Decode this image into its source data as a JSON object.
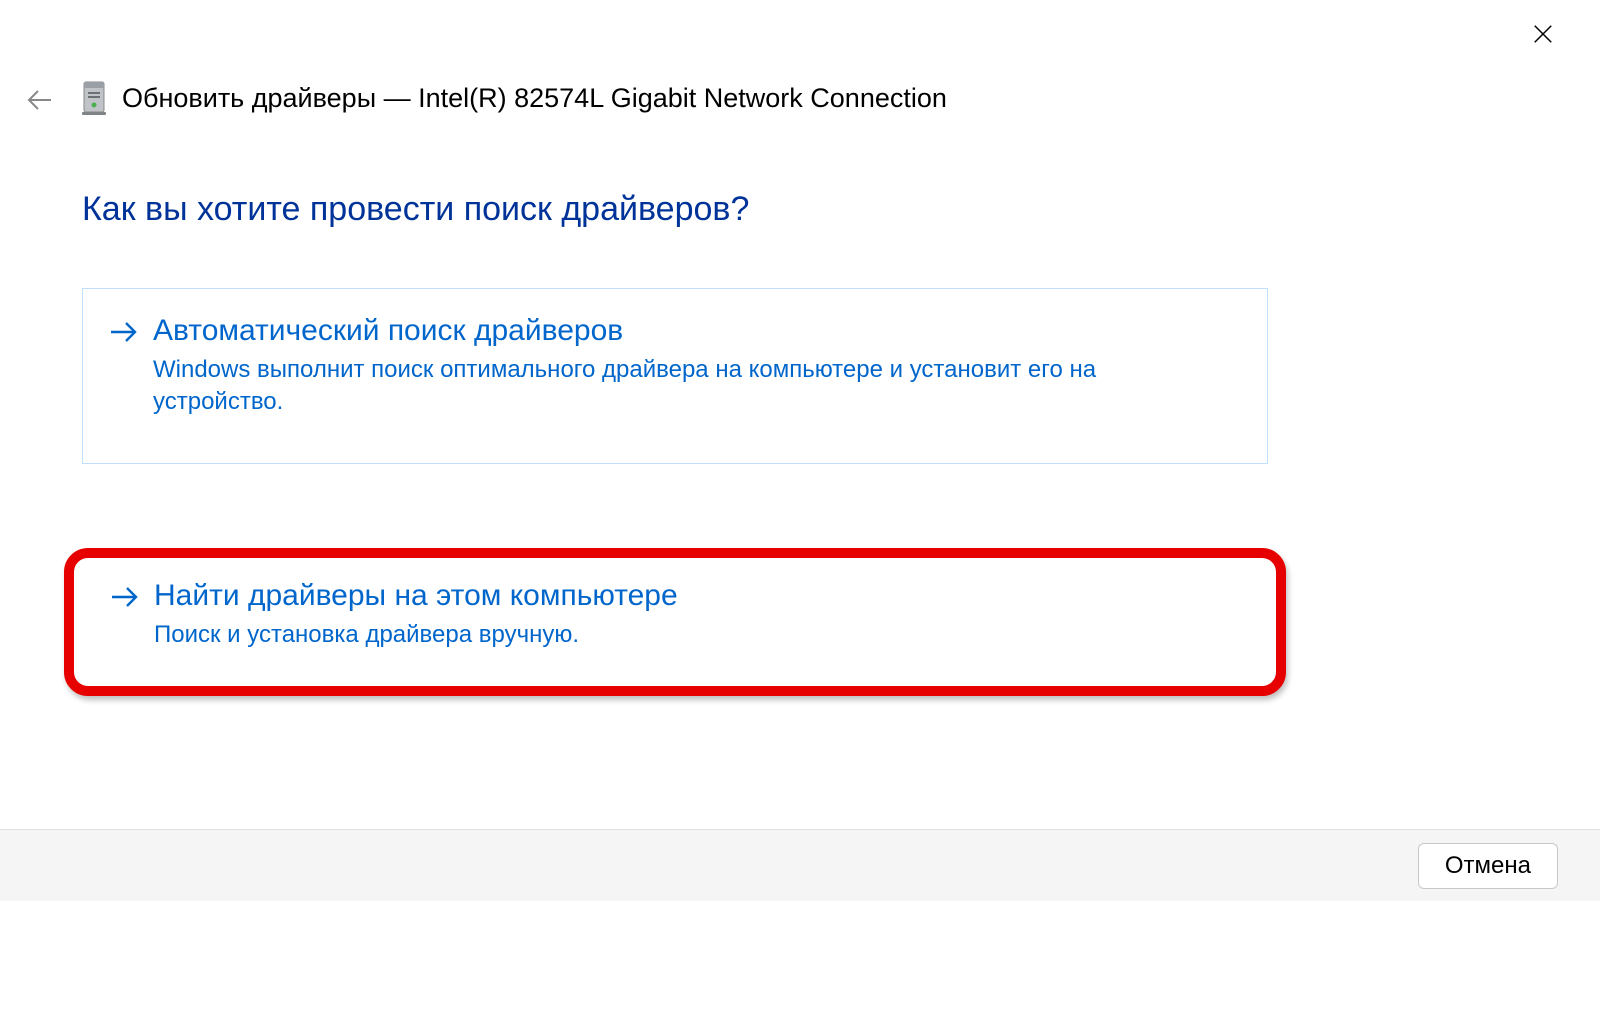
{
  "header": {
    "title": "Обновить драйверы — Intel(R) 82574L Gigabit Network Connection"
  },
  "question": "Как вы хотите провести поиск драйверов?",
  "options": {
    "auto": {
      "title": "Автоматический поиск драйверов",
      "description": "Windows выполнит поиск оптимального драйвера на компьютере и установит его на устройство."
    },
    "local": {
      "title": "Найти драйверы на этом компьютере",
      "description": "Поиск и установка драйвера вручную."
    }
  },
  "footer": {
    "cancel": "Отмена"
  },
  "highlight": "local"
}
